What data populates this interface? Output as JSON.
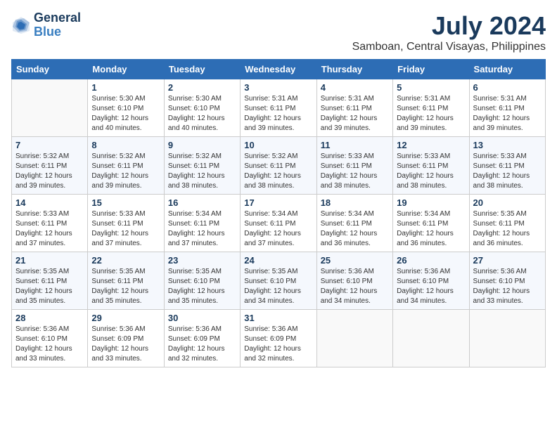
{
  "header": {
    "logo_line1": "General",
    "logo_line2": "Blue",
    "month": "July 2024",
    "location": "Samboan, Central Visayas, Philippines"
  },
  "weekdays": [
    "Sunday",
    "Monday",
    "Tuesday",
    "Wednesday",
    "Thursday",
    "Friday",
    "Saturday"
  ],
  "weeks": [
    [
      {
        "day": "",
        "info": ""
      },
      {
        "day": "1",
        "info": "Sunrise: 5:30 AM\nSunset: 6:10 PM\nDaylight: 12 hours\nand 40 minutes."
      },
      {
        "day": "2",
        "info": "Sunrise: 5:30 AM\nSunset: 6:10 PM\nDaylight: 12 hours\nand 40 minutes."
      },
      {
        "day": "3",
        "info": "Sunrise: 5:31 AM\nSunset: 6:11 PM\nDaylight: 12 hours\nand 39 minutes."
      },
      {
        "day": "4",
        "info": "Sunrise: 5:31 AM\nSunset: 6:11 PM\nDaylight: 12 hours\nand 39 minutes."
      },
      {
        "day": "5",
        "info": "Sunrise: 5:31 AM\nSunset: 6:11 PM\nDaylight: 12 hours\nand 39 minutes."
      },
      {
        "day": "6",
        "info": "Sunrise: 5:31 AM\nSunset: 6:11 PM\nDaylight: 12 hours\nand 39 minutes."
      }
    ],
    [
      {
        "day": "7",
        "info": "Sunrise: 5:32 AM\nSunset: 6:11 PM\nDaylight: 12 hours\nand 39 minutes."
      },
      {
        "day": "8",
        "info": "Sunrise: 5:32 AM\nSunset: 6:11 PM\nDaylight: 12 hours\nand 39 minutes."
      },
      {
        "day": "9",
        "info": "Sunrise: 5:32 AM\nSunset: 6:11 PM\nDaylight: 12 hours\nand 38 minutes."
      },
      {
        "day": "10",
        "info": "Sunrise: 5:32 AM\nSunset: 6:11 PM\nDaylight: 12 hours\nand 38 minutes."
      },
      {
        "day": "11",
        "info": "Sunrise: 5:33 AM\nSunset: 6:11 PM\nDaylight: 12 hours\nand 38 minutes."
      },
      {
        "day": "12",
        "info": "Sunrise: 5:33 AM\nSunset: 6:11 PM\nDaylight: 12 hours\nand 38 minutes."
      },
      {
        "day": "13",
        "info": "Sunrise: 5:33 AM\nSunset: 6:11 PM\nDaylight: 12 hours\nand 38 minutes."
      }
    ],
    [
      {
        "day": "14",
        "info": "Sunrise: 5:33 AM\nSunset: 6:11 PM\nDaylight: 12 hours\nand 37 minutes."
      },
      {
        "day": "15",
        "info": "Sunrise: 5:33 AM\nSunset: 6:11 PM\nDaylight: 12 hours\nand 37 minutes."
      },
      {
        "day": "16",
        "info": "Sunrise: 5:34 AM\nSunset: 6:11 PM\nDaylight: 12 hours\nand 37 minutes."
      },
      {
        "day": "17",
        "info": "Sunrise: 5:34 AM\nSunset: 6:11 PM\nDaylight: 12 hours\nand 37 minutes."
      },
      {
        "day": "18",
        "info": "Sunrise: 5:34 AM\nSunset: 6:11 PM\nDaylight: 12 hours\nand 36 minutes."
      },
      {
        "day": "19",
        "info": "Sunrise: 5:34 AM\nSunset: 6:11 PM\nDaylight: 12 hours\nand 36 minutes."
      },
      {
        "day": "20",
        "info": "Sunrise: 5:35 AM\nSunset: 6:11 PM\nDaylight: 12 hours\nand 36 minutes."
      }
    ],
    [
      {
        "day": "21",
        "info": "Sunrise: 5:35 AM\nSunset: 6:11 PM\nDaylight: 12 hours\nand 35 minutes."
      },
      {
        "day": "22",
        "info": "Sunrise: 5:35 AM\nSunset: 6:11 PM\nDaylight: 12 hours\nand 35 minutes."
      },
      {
        "day": "23",
        "info": "Sunrise: 5:35 AM\nSunset: 6:10 PM\nDaylight: 12 hours\nand 35 minutes."
      },
      {
        "day": "24",
        "info": "Sunrise: 5:35 AM\nSunset: 6:10 PM\nDaylight: 12 hours\nand 34 minutes."
      },
      {
        "day": "25",
        "info": "Sunrise: 5:36 AM\nSunset: 6:10 PM\nDaylight: 12 hours\nand 34 minutes."
      },
      {
        "day": "26",
        "info": "Sunrise: 5:36 AM\nSunset: 6:10 PM\nDaylight: 12 hours\nand 34 minutes."
      },
      {
        "day": "27",
        "info": "Sunrise: 5:36 AM\nSunset: 6:10 PM\nDaylight: 12 hours\nand 33 minutes."
      }
    ],
    [
      {
        "day": "28",
        "info": "Sunrise: 5:36 AM\nSunset: 6:10 PM\nDaylight: 12 hours\nand 33 minutes."
      },
      {
        "day": "29",
        "info": "Sunrise: 5:36 AM\nSunset: 6:09 PM\nDaylight: 12 hours\nand 33 minutes."
      },
      {
        "day": "30",
        "info": "Sunrise: 5:36 AM\nSunset: 6:09 PM\nDaylight: 12 hours\nand 32 minutes."
      },
      {
        "day": "31",
        "info": "Sunrise: 5:36 AM\nSunset: 6:09 PM\nDaylight: 12 hours\nand 32 minutes."
      },
      {
        "day": "",
        "info": ""
      },
      {
        "day": "",
        "info": ""
      },
      {
        "day": "",
        "info": ""
      }
    ]
  ]
}
